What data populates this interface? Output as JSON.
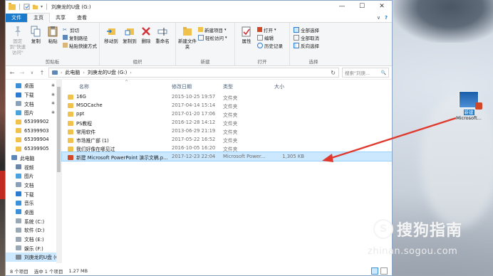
{
  "window": {
    "title": "刘庚龙的U盘 (G:)",
    "controls": {
      "minimize": "—",
      "maximize": "☐",
      "close": "✕"
    }
  },
  "tabs": {
    "file": "文件",
    "home": "主页",
    "share": "共享",
    "view": "查看",
    "help_icon": "?"
  },
  "ribbon": {
    "clipboard": {
      "pin_label": "固定到\"快速访问\"",
      "copy": "复制",
      "paste": "粘贴",
      "cut": "剪切",
      "copy_path": "复制路径",
      "paste_shortcut": "粘贴快捷方式",
      "group": "剪贴板"
    },
    "organize": {
      "move_to": "移动到",
      "copy_to": "复制到",
      "delete": "删除",
      "rename": "重命名",
      "group": "组织"
    },
    "new": {
      "new_folder": "新建文件夹",
      "new_item": "新建项目",
      "easy_access": "轻松访问",
      "group": "新建"
    },
    "open": {
      "properties": "属性",
      "open": "打开",
      "edit": "编辑",
      "history": "历史记录",
      "group": "打开"
    },
    "select": {
      "select_all": "全部选择",
      "select_none": "全部取消",
      "invert": "反向选择",
      "group": "选择"
    }
  },
  "address": {
    "crumbs": [
      "此电脑",
      "刘庚龙的U盘 (G:)"
    ],
    "search_placeholder": "搜索\"刘庚...",
    "back": "←",
    "forward": "→",
    "up": "↑",
    "recent": "∨",
    "refresh": "↻",
    "search_icon": "🔍"
  },
  "sidebar": {
    "items": [
      {
        "label": "桌面",
        "icon": "desktop-icon",
        "pinned": true
      },
      {
        "label": "下载",
        "icon": "download-icon",
        "pinned": true
      },
      {
        "label": "文档",
        "icon": "document-icon",
        "pinned": true
      },
      {
        "label": "图片",
        "icon": "picture-icon",
        "pinned": true
      },
      {
        "label": "65399902",
        "icon": "folder-icon",
        "pinned": false
      },
      {
        "label": "65399903",
        "icon": "folder-icon",
        "pinned": false
      },
      {
        "label": "65399904",
        "icon": "folder-icon",
        "pinned": false
      },
      {
        "label": "65399905",
        "icon": "folder-icon",
        "pinned": false
      },
      {
        "label": "此电脑",
        "icon": "computer-icon",
        "pinned": false
      },
      {
        "label": "视频",
        "icon": "video-icon",
        "pinned": false
      },
      {
        "label": "图片",
        "icon": "picture-icon",
        "pinned": false
      },
      {
        "label": "文档",
        "icon": "document-icon",
        "pinned": false
      },
      {
        "label": "下载",
        "icon": "download-icon",
        "pinned": false
      },
      {
        "label": "音乐",
        "icon": "music-icon",
        "pinned": false
      },
      {
        "label": "桌面",
        "icon": "desktop-icon",
        "pinned": false
      },
      {
        "label": "系统 (C:)",
        "icon": "drive-icon",
        "pinned": false
      },
      {
        "label": "软件 (D:)",
        "icon": "drive-icon",
        "pinned": false
      },
      {
        "label": "文档 (E:)",
        "icon": "drive-icon",
        "pinned": false
      },
      {
        "label": "娱乐 (F:)",
        "icon": "drive-icon",
        "pinned": false
      },
      {
        "label": "刘庚龙的U盘 (G:)",
        "icon": "usb-drive-icon",
        "pinned": false
      }
    ]
  },
  "columns": {
    "name": "名称",
    "date": "修改日期",
    "type": "类型",
    "size": "大小"
  },
  "files": [
    {
      "name": "16G",
      "date": "2015-10-25 19:57",
      "type": "文件夹",
      "size": ""
    },
    {
      "name": "MSOCache",
      "date": "2017-04-14 15:14",
      "type": "文件夹",
      "size": ""
    },
    {
      "name": "ppt",
      "date": "2017-01-20 17:06",
      "type": "文件夹",
      "size": ""
    },
    {
      "name": "PS教程",
      "date": "2016-12-28 14:12",
      "type": "文件夹",
      "size": ""
    },
    {
      "name": "常用软件",
      "date": "2013-06-29 21:19",
      "type": "文件夹",
      "size": ""
    },
    {
      "name": "市场推广部 (1)",
      "date": "2017-05-22 16:52",
      "type": "文件夹",
      "size": ""
    },
    {
      "name": "我们好像在哪见过",
      "date": "2016-10-05 16:20",
      "type": "文件夹",
      "size": ""
    },
    {
      "name": "新建 Microsoft PowerPoint 演示文稿.p...",
      "date": "2017-12-23 22:04",
      "type": "Microsoft Power...",
      "size": "1,305 KB",
      "selected": true
    }
  ],
  "status": {
    "count": "8 个项目",
    "selected": "选中 1 个项目",
    "size": "1.27 MB"
  },
  "desktop": {
    "icon_label_1": "新建",
    "icon_label_2": "Microsoft..."
  },
  "watermark": {
    "logo": "S",
    "text": "搜狗指南",
    "url": "zhinan.sogou.com"
  },
  "colors": {
    "accent": "#1979ca",
    "selection": "#cce8ff",
    "arrow": "#e03a2f",
    "folder": "#f0c14b"
  }
}
